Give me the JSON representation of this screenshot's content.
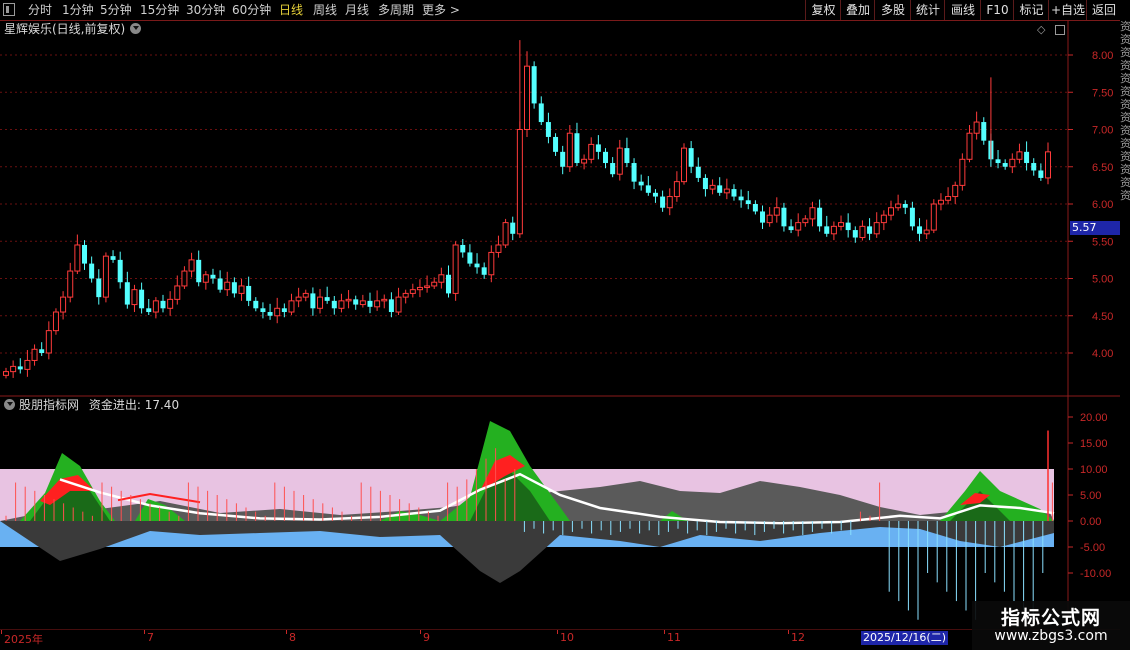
{
  "toolbar": {
    "periods": [
      "分时",
      "1分钟",
      "5分钟",
      "15分钟",
      "30分钟",
      "60分钟",
      "日线",
      "周线",
      "月线",
      "多周期",
      "更多 >"
    ],
    "active_period": "日线",
    "buttons": [
      "复权",
      "叠加",
      "多股",
      "统计",
      "画线",
      "F10",
      "标记",
      "+自选",
      "返回"
    ]
  },
  "main_title": "星辉娱乐(日线,前复权)",
  "current_price_tag": "5.57",
  "indicator": {
    "name": "股朋指标网",
    "value_label": "资金进出:",
    "value": "17.40"
  },
  "colors": {
    "up": "#ff3b3b",
    "down": "#54ffff",
    "grid": "#6a1010",
    "axis_text": "#c82828"
  },
  "date_axis": {
    "labels": [
      "2025年",
      "7",
      "8",
      "9",
      "10",
      "11",
      "12"
    ],
    "cursor_date": "2025/12/16(二)"
  },
  "watermark": {
    "title": "指标公式网",
    "url": "www.zbgs3.com"
  },
  "right_strip_text": "资资资资资资资资资资资资资资",
  "chart_data": [
    {
      "type": "candlestick",
      "title": "星辉娱乐(日线,前复权)",
      "y_ticks": [
        4.0,
        4.5,
        5.0,
        5.5,
        6.0,
        6.5,
        7.0,
        7.5,
        8.0
      ],
      "ylim": [
        3.55,
        8.3
      ],
      "x_labels": [
        "2025年",
        "7",
        "8",
        "9",
        "10",
        "11",
        "12"
      ],
      "x_label_positions": [
        0,
        20,
        40,
        60,
        80,
        95,
        115
      ],
      "closes": [
        3.75,
        3.82,
        3.78,
        3.9,
        4.05,
        4.0,
        4.3,
        4.55,
        4.75,
        5.1,
        5.45,
        5.2,
        5.0,
        4.75,
        5.3,
        5.25,
        4.95,
        4.65,
        4.85,
        4.6,
        4.55,
        4.7,
        4.6,
        4.72,
        4.9,
        5.1,
        5.25,
        4.95,
        5.05,
        5.0,
        4.85,
        4.95,
        4.8,
        4.9,
        4.7,
        4.6,
        4.55,
        4.5,
        4.6,
        4.55,
        4.7,
        4.75,
        4.8,
        4.6,
        4.75,
        4.7,
        4.6,
        4.7,
        4.72,
        4.65,
        4.7,
        4.62,
        4.7,
        4.72,
        4.55,
        4.75,
        4.8,
        4.85,
        4.88,
        4.9,
        4.95,
        5.05,
        4.8,
        5.45,
        5.35,
        5.2,
        5.15,
        5.05,
        5.35,
        5.45,
        5.75,
        5.6,
        7.0,
        7.85,
        7.35,
        7.1,
        6.9,
        6.7,
        6.5,
        6.95,
        6.55,
        6.6,
        6.8,
        6.7,
        6.55,
        6.4,
        6.75,
        6.55,
        6.3,
        6.25,
        6.15,
        6.1,
        5.95,
        6.1,
        6.3,
        6.75,
        6.5,
        6.35,
        6.2,
        6.25,
        6.15,
        6.2,
        6.1,
        6.05,
        6.0,
        5.9,
        5.75,
        5.85,
        5.95,
        5.7,
        5.65,
        5.75,
        5.8,
        5.95,
        5.7,
        5.6,
        5.7,
        5.75,
        5.65,
        5.55,
        5.7,
        5.6,
        5.75,
        5.85,
        5.95,
        6.0,
        5.95,
        5.7,
        5.6,
        5.65,
        6.0,
        6.05,
        6.1,
        6.25,
        6.6,
        6.95,
        7.1,
        6.85,
        6.6,
        6.55,
        6.5,
        6.6,
        6.7,
        6.55,
        6.45,
        6.35,
        6.7
      ],
      "current_price": 5.57
    },
    {
      "type": "area",
      "title": "股朋指标网",
      "y_ticks": [
        -10.0,
        -5.0,
        0.0,
        5.0,
        10.0,
        15.0,
        20.0
      ],
      "ylim": [
        -14.5,
        21.5
      ],
      "series": [
        {
          "name": "资金进出",
          "last_value": 17.4
        }
      ],
      "band": [
        -5.0,
        10.0
      ]
    }
  ]
}
